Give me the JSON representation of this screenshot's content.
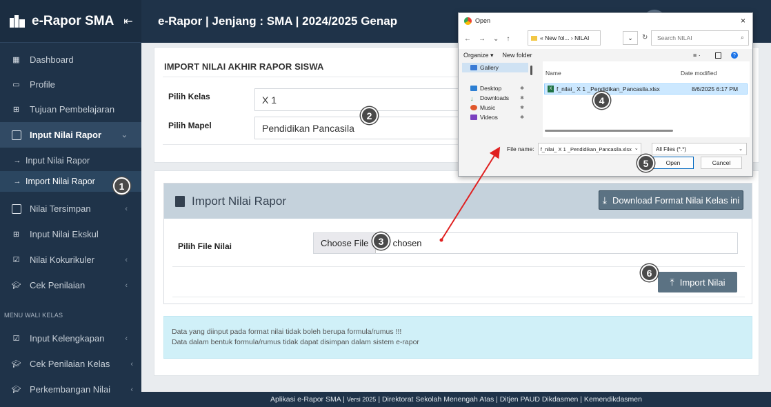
{
  "brand": {
    "title": "e-Rapor SMA",
    "collapse_icon": "collapse-left-icon"
  },
  "topbar": {
    "title": "e-Rapor | Jenjang : SMA | 2024/2025 Genap"
  },
  "sidebar": {
    "items": [
      {
        "label": "Dashboard",
        "icon": "dashboard-icon"
      },
      {
        "label": "Profile",
        "icon": "profile-icon"
      },
      {
        "label": "Tujuan Pembelajaran",
        "icon": "plus-square-icon"
      },
      {
        "label": "Input Nilai Rapor",
        "icon": "square-icon"
      },
      {
        "label": "Input Nilai Rapor"
      },
      {
        "label": "Import Nilai Rapor"
      },
      {
        "label": "Nilai Tersimpan",
        "icon": "square-icon"
      },
      {
        "label": "Input Nilai Ekskul",
        "icon": "plus-square-icon"
      },
      {
        "label": "Nilai Kokurikuler",
        "icon": "check-square-icon"
      },
      {
        "label": "Cek Penilaian",
        "icon": "graduation-cap-icon"
      },
      {
        "label": "Input Kelengkapan",
        "icon": "check-square-icon"
      },
      {
        "label": "Cek Penilaian Kelas",
        "icon": "graduation-cap-icon"
      },
      {
        "label": "Perkembangan Nilai",
        "icon": "graduation-cap-icon"
      }
    ],
    "section_wali": "MENU WALI KELAS"
  },
  "import_card": {
    "title": "IMPORT NILAI AKHIR RAPOR SISWA",
    "kelas_label": "Pilih Kelas",
    "kelas_value": "X 1",
    "mapel_label": "Pilih Mapel",
    "mapel_value": "Pendidikan Pancasila"
  },
  "rapor_panel": {
    "title": "Import Nilai Rapor",
    "download_button": "Download Format Nilai Kelas ini",
    "file_label": "Pilih File Nilai",
    "choose_button": "Choose File",
    "file_status": "file chosen",
    "import_button": "Import Nilai"
  },
  "alert": {
    "line1": "Data yang diinput pada format nilai tidak boleh berupa formula/rumus !!!",
    "line2": "Data dalam bentuk formula/rumus tidak dapat disimpan dalam sistem e-rapor"
  },
  "footer": {
    "app": "Aplikasi e-Rapor SMA |",
    "version": "Versi 2025",
    "rest": "| Direktorat Sekolah Menengah Atas | Ditjen PAUD Dikdasmen | Kemendikdasmen"
  },
  "dialog": {
    "title": "Open",
    "close": "×",
    "address": "« New fol... › NILAI",
    "search_placeholder": "Search NILAI",
    "organize": "Organize ▾",
    "new_folder": "New folder",
    "quick_access": [
      {
        "label": "Gallery",
        "color": "#3a7bd5"
      },
      {
        "label": "Desktop",
        "color": "#2d7fd3"
      },
      {
        "label": "Downloads",
        "color": "#2d8f4e"
      },
      {
        "label": "Music",
        "color": "#e0572b"
      },
      {
        "label": "Videos",
        "color": "#7a3fbf"
      }
    ],
    "col_name": "Name",
    "col_date": "Date modified",
    "file_name": "f_nilai_ X 1 _Pendidikan_Pancasila.xlsx",
    "file_date": "8/6/2025 6:17 PM",
    "filename_label": "File name:",
    "filename_value": "f_nilai_ X 1 _Pendidikan_Pancasila.xlsx",
    "filetype": "All Files (*.*)",
    "open_button": "Open",
    "cancel_button": "Cancel"
  },
  "markers": [
    "1",
    "2",
    "3",
    "4",
    "5",
    "6"
  ],
  "colors": {
    "sidebar": "#1f3349",
    "panel_header": "#c5d2dc",
    "button": "#5b7283",
    "alert": "#d0f0f8",
    "arrow": "#e02020"
  }
}
